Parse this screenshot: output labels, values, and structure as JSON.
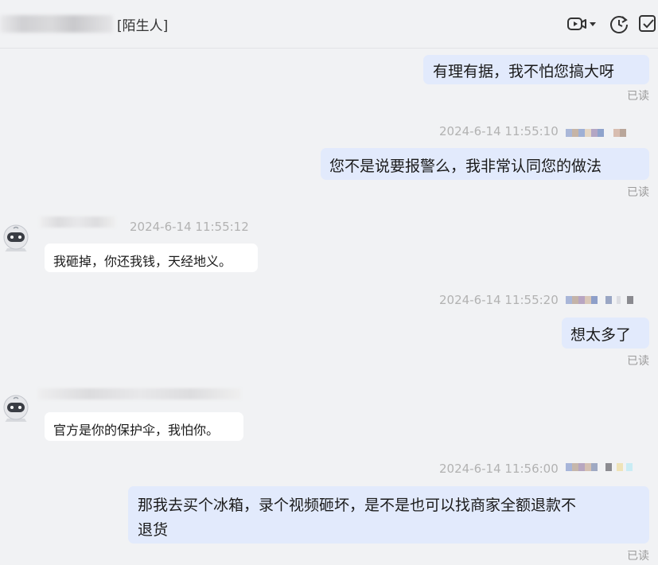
{
  "header": {
    "tag": "[陌生人]"
  },
  "messages": {
    "m1": {
      "text": "有理有据，我不怕您搞大呀",
      "status": "已读"
    },
    "m2": {
      "time": "2024-6-14 11:55:10",
      "text": "您不是说要报警么，我非常认同您的做法",
      "status": "已读"
    },
    "m3": {
      "time": "2024-6-14 11:55:12",
      "text": "我砸掉，你还我钱，天经地义。"
    },
    "m4": {
      "time": "2024-6-14 11:55:20",
      "text": "想太多了",
      "status": "已读"
    },
    "m5": {
      "text": "官方是你的保护伞，我怕你。"
    },
    "m6": {
      "time": "2024-6-14 11:56:00",
      "text_line1": "那我去买个冰箱，录个视频砸坏，是不是也可以找商家全额退款不",
      "text_line2": "退货",
      "status": "已读"
    }
  },
  "icons": {
    "header": [
      "video-call-icon",
      "dropdown-arrow-icon",
      "history-icon",
      "checklist-icon"
    ],
    "avatar": "robot-avatar-icon"
  },
  "colors": {
    "background": "#f1f2f4",
    "outgoing_bubble": "#e2eafc",
    "incoming_bubble": "#ffffff",
    "timestamp": "#b2b2b2"
  }
}
